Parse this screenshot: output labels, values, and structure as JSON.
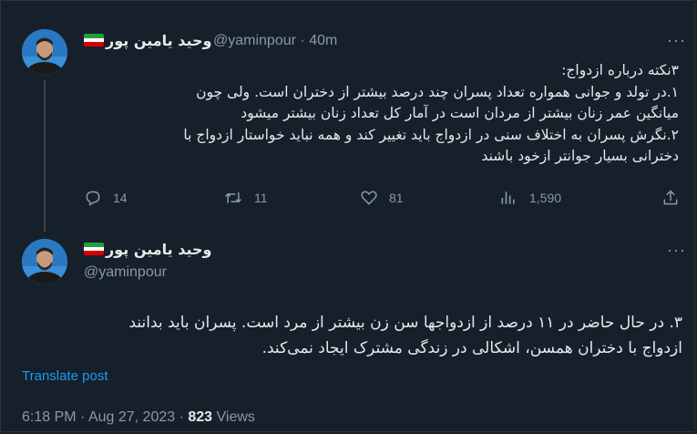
{
  "post1": {
    "display_name": "وحید یامین پور",
    "handle": "@yaminpour",
    "separator": "·",
    "time": "40m",
    "more": "···",
    "lines": [
      "۳نکته درباره ازدواج:",
      "۱.در تولد و جوانی همواره تعداد پسران چند درصد بیشتر از دختران است. ولی چون",
      "میانگین عمر زنان بیشتر از مردان است در آمار کل تعداد زنان بیشتر میشود",
      "۲.نگرش پسران به اختلاف سنی در ازدواج باید تغییر کند و همه نباید خواستار ازدواج با",
      "دخترانی بسیار جوانتر ازخود باشند"
    ],
    "replies": "14",
    "reposts": "11",
    "likes": "81",
    "views": "1,590"
  },
  "post2": {
    "display_name": "وحید یامین پور",
    "handle": "@yaminpour",
    "more": "···",
    "lines": [
      "۳. در حال حاضر در ۱۱ درصد از ازدواجها سن زن بیشتر از مرد است. پسران باید بدانند",
      "ازدواج با دختران همسن، اشکالی در زندگی مشترک ایجاد نمی‌کند."
    ],
    "translate": "Translate post",
    "time": "6:18 PM",
    "dot1": "·",
    "date": "Aug 27, 2023",
    "dot2": "·",
    "views_count": "823",
    "views_label": "Views"
  },
  "colors": {
    "background": "#15202b",
    "text": "#e7e9ea",
    "secondary": "#8b98a5",
    "link": "#1d9bf0"
  },
  "icons": [
    "reply-icon",
    "repost-icon",
    "like-icon",
    "views-icon",
    "share-icon"
  ]
}
